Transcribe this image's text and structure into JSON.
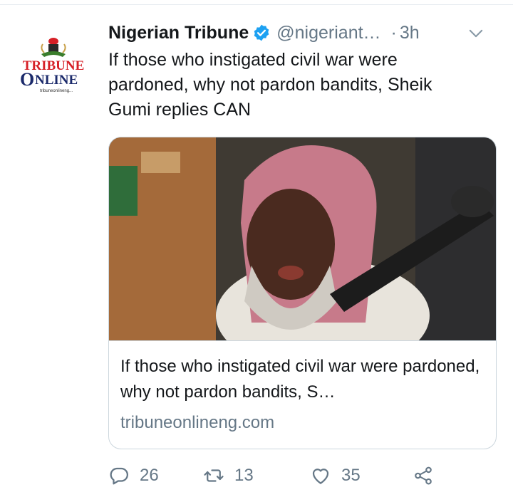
{
  "tweet": {
    "author_name": "Nigerian Tribune",
    "handle": "@nigeriant…",
    "separator": "·",
    "time": "3h",
    "text": "If those who instigated civil war were pardoned, why not pardon bandits, Sheik Gumi replies CAN",
    "avatar": {
      "logo_line1": "TRIBUNE",
      "logo_line2": "NLINE",
      "logo_url": "tribuneonlineng..."
    },
    "card": {
      "title": "If those who instigated civil war were pardoned, why not pardon bandits, S…",
      "domain": "tribuneonlineng.com"
    },
    "actions": {
      "reply_count": "26",
      "retweet_count": "13",
      "like_count": "35"
    },
    "icons": {
      "verified": "verified-badge-icon",
      "caret": "chevron-down-icon",
      "reply": "reply-icon",
      "retweet": "retweet-icon",
      "like": "heart-icon",
      "share": "share-icon"
    },
    "colors": {
      "brand_red": "#d62027",
      "brand_navy": "#1b2a6b",
      "verified_blue": "#1da1f2",
      "secondary_text": "#657786"
    }
  }
}
